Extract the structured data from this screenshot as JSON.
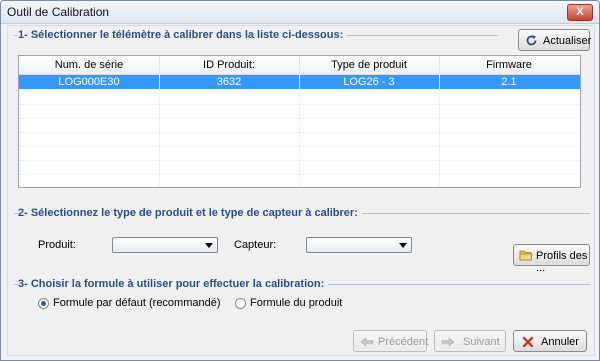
{
  "window": {
    "title": "Outil de Calibration",
    "close_label": "X"
  },
  "section1": {
    "heading": "1- Sélectionner le télémètre à calibrer dans la liste ci-dessous:",
    "refresh_label": "Actualiser"
  },
  "table": {
    "columns": [
      "Num. de série",
      "ID Produit:",
      "Type de produit",
      "Firmware"
    ],
    "rows": [
      {
        "serial": "LOG000E30",
        "id": "3632",
        "type": "LOG26 - 3",
        "firmware": "2.1",
        "selected": true
      }
    ]
  },
  "section2": {
    "heading": "2- Sélectionnez le type de produit et le type de capteur à calibrer:",
    "produit_label": "Produit:",
    "produit_value": "",
    "capteur_label": "Capteur:",
    "capteur_value": "",
    "profiles_label": "Profils des ..."
  },
  "section3": {
    "heading": "3- Choisir la formule à utiliser pour effectuer la calibration:",
    "option_default": "Formule par défaut (recommandé)",
    "option_product": "Formule du produit",
    "selected": "default"
  },
  "footer": {
    "previous_label": "Précédent",
    "next_label": "Suivant",
    "cancel_label": "Annuler"
  },
  "colors": {
    "accent": "#3399ff",
    "heading": "#2b4e8c",
    "cancel_icon": "#c0392b"
  }
}
